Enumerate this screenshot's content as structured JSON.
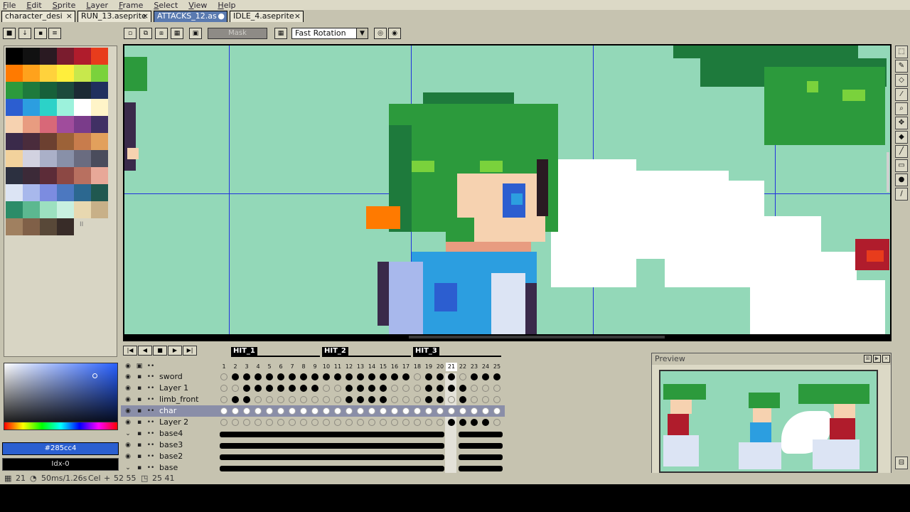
{
  "menu": [
    "File",
    "Edit",
    "Sprite",
    "Layer",
    "Frame",
    "Select",
    "View",
    "Help"
  ],
  "tabs": [
    {
      "label": "character_desi",
      "close": "×"
    },
    {
      "label": "RUN_13.aseprite",
      "close": "×"
    },
    {
      "label": "ATTACKS_12.as",
      "close": "●"
    },
    {
      "label": "IDLE_4.aseprite",
      "close": "×"
    }
  ],
  "toolbar": {
    "mask_label": "Mask",
    "rotation_algorithm": "Fast Rotation",
    "dropdown_arrow": "▼"
  },
  "palette": {
    "colors": [
      "#000000",
      "#111111",
      "#2a1a22",
      "#7a1c2e",
      "#b01c2c",
      "#e83c1c",
      "#ff7a00",
      "#ffa21c",
      "#ffd23c",
      "#ffee3c",
      "#c8e84c",
      "#7ad23c",
      "#2c9a3c",
      "#1e7a3c",
      "#17603a",
      "#1c4a3c",
      "#1c2a34",
      "#20305e",
      "#2c5ed0",
      "#2c9ee0",
      "#2cd2c8",
      "#9cf2dc",
      "#ffffff",
      "#fff4c8",
      "#f6d2b0",
      "#e89c80",
      "#d86878",
      "#a04c9c",
      "#7a3c8a",
      "#403064",
      "#3a2a4a",
      "#4a2c3c",
      "#6c4030",
      "#9c6238",
      "#c87c4c",
      "#e2a05c",
      "#f2d29c",
      "#d2d2e0",
      "#aab0c8",
      "#8890a8",
      "#6a6c80",
      "#4a4c5c",
      "#2c3040",
      "#3c2a38",
      "#5c2c38",
      "#8c4844",
      "#b87060",
      "#e8a898",
      "#dce4f4",
      "#a8b8ec",
      "#7c8ce0",
      "#4c78c0",
      "#2c6890",
      "#205850",
      "#2c8c68",
      "#5cb890",
      "#9ce0c0",
      "#c8f0e0",
      "#e8d8b0",
      "#c8b088",
      "#a08060",
      "#806048",
      "#584838",
      "#382c28"
    ],
    "extra_label": "II"
  },
  "color": {
    "hex": "#285cc4",
    "index": "Idx-0"
  },
  "timeline": {
    "tags": [
      "HIT_1",
      "HIT_2",
      "HIT_3"
    ],
    "frames": [
      "1",
      "2",
      "3",
      "4",
      "5",
      "6",
      "7",
      "8",
      "9",
      "10",
      "11",
      "12",
      "13",
      "14",
      "15",
      "16",
      "17",
      "18",
      "19",
      "20",
      "21",
      "22",
      "23",
      "24",
      "25"
    ],
    "active_frame": "21",
    "layers": [
      {
        "name": "sword",
        "visible": "👁",
        "lock": "🔒",
        "cels": "0111111111111111101110111"
      },
      {
        "name": "Layer 1",
        "visible": "👁",
        "lock": "🔒",
        "cels": "0011111110011110001111000"
      },
      {
        "name": "limb_front",
        "visible": "👁",
        "lock": "🔒",
        "cels": "0110000000011110001101000"
      },
      {
        "name": "char",
        "visible": "👁",
        "lock": "🔒",
        "cels": "2222222222222222222222222"
      },
      {
        "name": "Layer 2",
        "visible": "👁",
        "lock": "🔒",
        "cels": "0000000000000000000011110"
      },
      {
        "name": "base4",
        "visible": "",
        "lock": "🔒",
        "cels": "bar"
      },
      {
        "name": "base3",
        "visible": "👁",
        "lock": "🔒",
        "cels": "bar"
      },
      {
        "name": "base2",
        "visible": "👁",
        "lock": "🔒",
        "cels": "bar"
      },
      {
        "name": "base",
        "visible": "",
        "lock": "🔒",
        "cels": "bar"
      }
    ],
    "active_layer": "char"
  },
  "preview": {
    "title": "Preview"
  },
  "status": {
    "frame": "21",
    "duration": "50ms/1.26s",
    "cel": "Cel",
    "pos": "52 55",
    "size": "25 41"
  }
}
